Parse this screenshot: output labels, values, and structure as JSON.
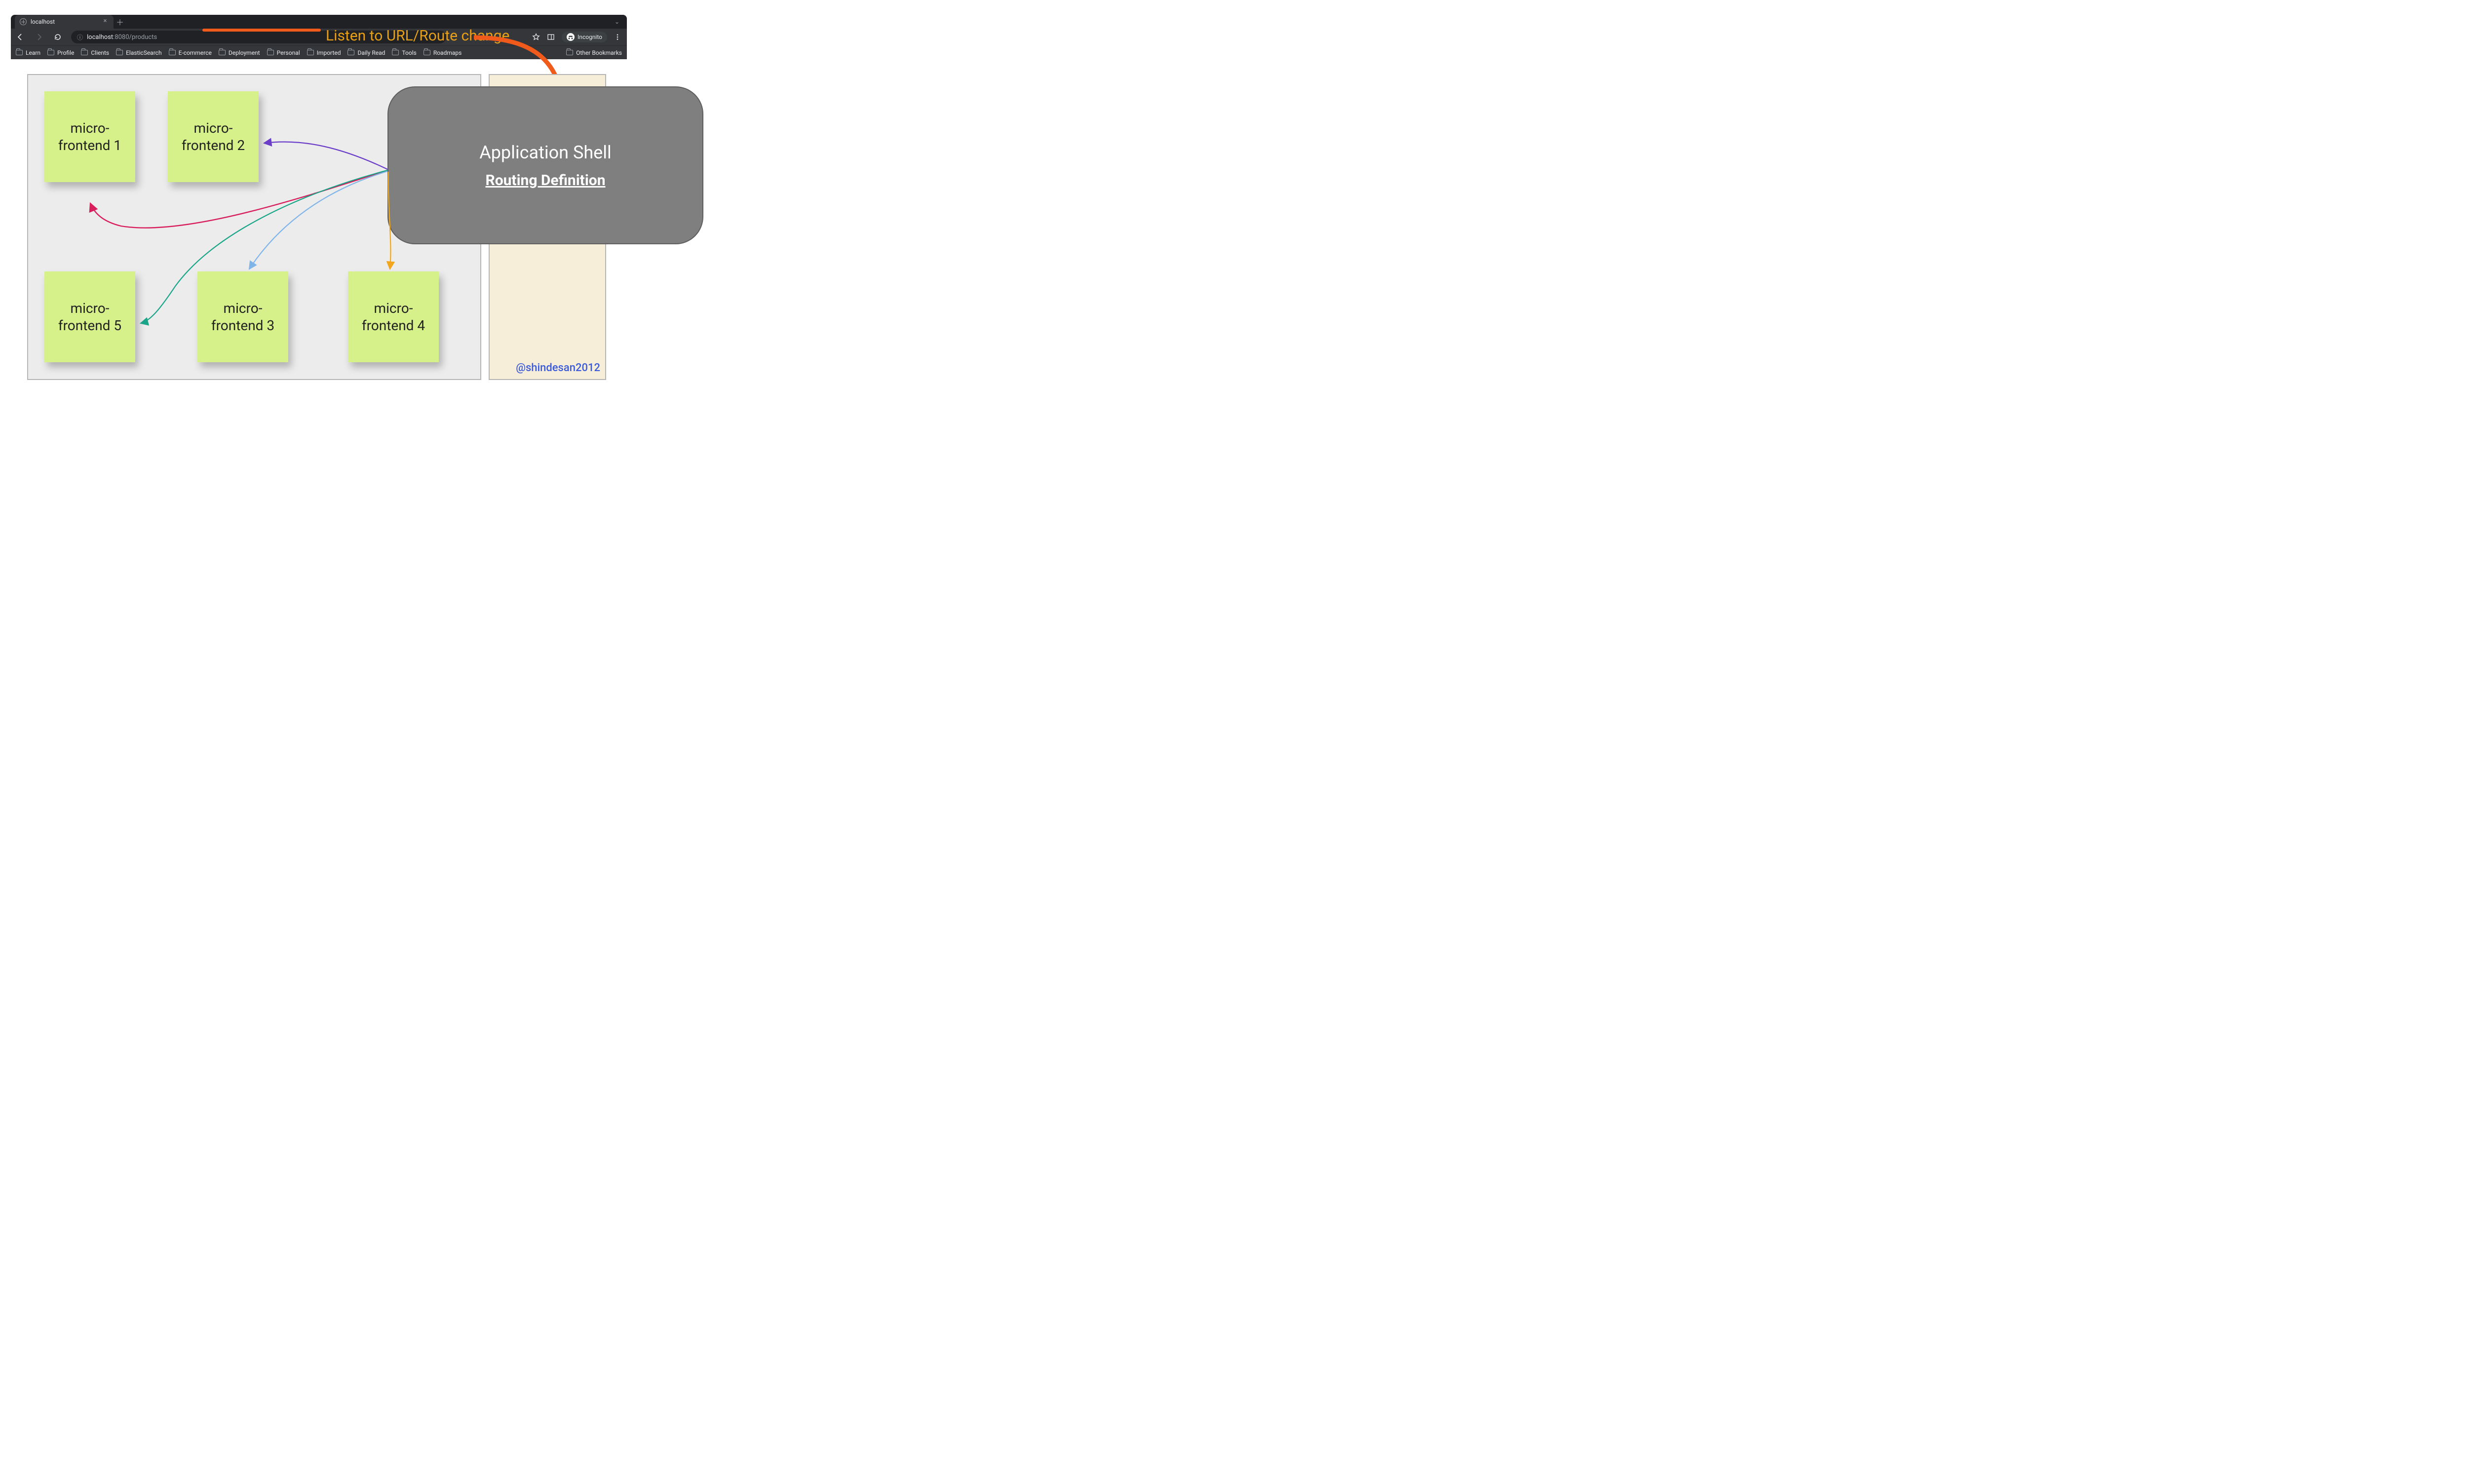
{
  "browser": {
    "tab_title": "localhost",
    "url_host": "localhost",
    "url_rest": ":8080/products",
    "incognito_label": "Incognito",
    "bookmarks": [
      "Learn",
      "Profile",
      "Clients",
      "ElasticSearch",
      "E-commerce",
      "Deployment",
      "Personal",
      "Imported",
      "Daily Read",
      "Tools",
      "Roadmaps"
    ],
    "other_bookmarks": "Other Bookmarks"
  },
  "annotation": "Listen to URL/Route change",
  "shell": {
    "title": "Application Shell",
    "subtitle": "Routing Definition"
  },
  "notes": {
    "n1": "micro-frontend 1",
    "n2": "micro-frontend 2",
    "n3": "micro-frontend 3",
    "n4": "micro-frontend 4",
    "n5": "micro-frontend 5"
  },
  "attribution": "@shindesan2012",
  "colors": {
    "accent_orange": "#f05a1b",
    "annot_yellow": "#e7a018",
    "arrow_purple": "#6a3ec8",
    "arrow_teal": "#1aa589",
    "arrow_pink": "#d81e5b",
    "arrow_blue": "#7fb4e8",
    "arrow_amber": "#f2a61d"
  }
}
